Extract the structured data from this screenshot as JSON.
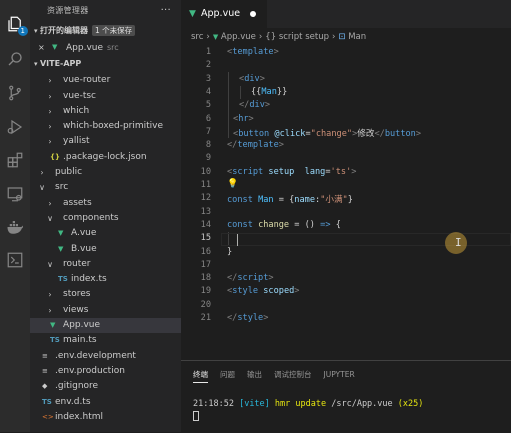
{
  "activity_bar": {
    "items": [
      "explorer-icon",
      "search-icon",
      "source-control-icon",
      "run-debug-icon",
      "extensions-icon",
      "remote-explorer-icon",
      "docker-icon",
      "terminal-icon"
    ],
    "explorer_badge": "1"
  },
  "sidebar": {
    "title": "资源管理器",
    "more": "···",
    "open_editors": {
      "header": "打开的编辑器",
      "unsaved_badge": "1 个未保存",
      "items": [
        {
          "close": "×",
          "name": "App.vue",
          "desc": "src"
        }
      ]
    },
    "project": {
      "header": "VITE-APP",
      "tree": [
        {
          "label": "vue-router",
          "type": "folder",
          "open": false,
          "depth": 1
        },
        {
          "label": "vue-tsc",
          "type": "folder",
          "open": false,
          "depth": 1
        },
        {
          "label": "which",
          "type": "folder",
          "open": false,
          "depth": 1
        },
        {
          "label": "which-boxed-primitive",
          "type": "folder",
          "open": false,
          "depth": 1
        },
        {
          "label": "yallist",
          "type": "folder",
          "open": false,
          "depth": 1
        },
        {
          "label": ".package-lock.json",
          "type": "json",
          "depth": 1
        },
        {
          "label": "public",
          "type": "folder",
          "open": false,
          "depth": 0
        },
        {
          "label": "src",
          "type": "folder",
          "open": true,
          "depth": 0
        },
        {
          "label": "assets",
          "type": "folder",
          "open": false,
          "depth": 1
        },
        {
          "label": "components",
          "type": "folder",
          "open": true,
          "depth": 1
        },
        {
          "label": "A.vue",
          "type": "vue",
          "depth": 2
        },
        {
          "label": "B.vue",
          "type": "vue",
          "depth": 2
        },
        {
          "label": "router",
          "type": "folder",
          "open": true,
          "depth": 1
        },
        {
          "label": "index.ts",
          "type": "ts",
          "depth": 2
        },
        {
          "label": "stores",
          "type": "folder",
          "open": false,
          "depth": 1
        },
        {
          "label": "views",
          "type": "folder",
          "open": false,
          "depth": 1
        },
        {
          "label": "App.vue",
          "type": "vue",
          "depth": 1,
          "active": true
        },
        {
          "label": "main.ts",
          "type": "ts",
          "depth": 1
        },
        {
          "label": ".env.development",
          "type": "env",
          "depth": 0
        },
        {
          "label": ".env.production",
          "type": "env",
          "depth": 0
        },
        {
          "label": ".gitignore",
          "type": "git",
          "depth": 0
        },
        {
          "label": "env.d.ts",
          "type": "ts",
          "depth": 0
        },
        {
          "label": "index.html",
          "type": "html",
          "depth": 0
        }
      ]
    }
  },
  "editor": {
    "tab": {
      "name": "App.vue",
      "modified": true
    },
    "breadcrumb": [
      "src",
      "App.vue",
      "{} script setup",
      "Man"
    ],
    "lines": [
      {
        "n": "1",
        "tokens": [
          [
            "brk",
            "<"
          ],
          [
            "tag",
            "template"
          ],
          [
            "brk",
            ">"
          ]
        ],
        "indent": 0
      },
      {
        "n": "2",
        "tokens": [],
        "indent": 0
      },
      {
        "n": "3",
        "tokens": [
          [
            "brk",
            "<"
          ],
          [
            "tag",
            "div"
          ],
          [
            "brk",
            ">"
          ]
        ],
        "indent": 1
      },
      {
        "n": "4",
        "tokens": [
          [
            "mus",
            "{{"
          ],
          [
            "var",
            "Man"
          ],
          [
            "mus",
            "}}"
          ]
        ],
        "indent": 2
      },
      {
        "n": "5",
        "tokens": [
          [
            "brk",
            "</"
          ],
          [
            "tag",
            "div"
          ],
          [
            "brk",
            ">"
          ]
        ],
        "indent": 1
      },
      {
        "n": "6",
        "tokens": [
          [
            "brk",
            "<"
          ],
          [
            "tag",
            "hr"
          ],
          [
            "brk",
            ">"
          ]
        ],
        "indent": 0.5
      },
      {
        "n": "7",
        "tokens": [
          [
            "brk",
            "<"
          ],
          [
            "tag",
            "button"
          ],
          [
            "txt",
            " "
          ],
          [
            "attr",
            "@click"
          ],
          [
            "txt",
            "="
          ],
          [
            "str",
            "\"change\""
          ],
          [
            "brk",
            ">"
          ],
          [
            "txt",
            "修改"
          ],
          [
            "brk",
            "</"
          ],
          [
            "tag",
            "button"
          ],
          [
            "brk",
            ">"
          ]
        ],
        "indent": 0.5
      },
      {
        "n": "8",
        "tokens": [
          [
            "brk",
            "</"
          ],
          [
            "tag",
            "template"
          ],
          [
            "brk",
            ">"
          ]
        ],
        "indent": 0
      },
      {
        "n": "9",
        "tokens": [],
        "indent": 0
      },
      {
        "n": "10",
        "tokens": [
          [
            "brk",
            "<"
          ],
          [
            "tag",
            "script"
          ],
          [
            "txt",
            " "
          ],
          [
            "attr",
            "setup"
          ],
          [
            "txt",
            "  "
          ],
          [
            "attr",
            "lang"
          ],
          [
            "txt",
            "="
          ],
          [
            "str",
            "'ts'"
          ],
          [
            "brk",
            ">"
          ]
        ],
        "indent": 0
      },
      {
        "n": "11",
        "tokens": [],
        "indent": 0,
        "bulb": "💡"
      },
      {
        "n": "12",
        "tokens": [
          [
            "kw",
            "const"
          ],
          [
            "txt",
            " "
          ],
          [
            "var",
            "Man"
          ],
          [
            "txt",
            " = {"
          ],
          [
            "attr",
            "name"
          ],
          [
            "txt",
            ":"
          ],
          [
            "str",
            "\"小满\""
          ],
          [
            "txt",
            "}"
          ]
        ],
        "indent": 0
      },
      {
        "n": "13",
        "tokens": [],
        "indent": 0
      },
      {
        "n": "14",
        "tokens": [
          [
            "kw",
            "const"
          ],
          [
            "txt",
            " "
          ],
          [
            "fn",
            "change"
          ],
          [
            "txt",
            " = () "
          ],
          [
            "kw",
            "=>"
          ],
          [
            "txt",
            " {"
          ]
        ],
        "indent": 0
      },
      {
        "n": "15",
        "tokens": [],
        "indent": 0,
        "current": true
      },
      {
        "n": "16",
        "tokens": [
          [
            "txt",
            "}"
          ]
        ],
        "indent": 0
      },
      {
        "n": "17",
        "tokens": [],
        "indent": 0
      },
      {
        "n": "18",
        "tokens": [
          [
            "brk",
            "</"
          ],
          [
            "tag",
            "script"
          ],
          [
            "brk",
            ">"
          ]
        ],
        "indent": 0
      },
      {
        "n": "19",
        "tokens": [
          [
            "brk",
            "<"
          ],
          [
            "tag",
            "style"
          ],
          [
            "txt",
            " "
          ],
          [
            "attr",
            "scoped"
          ],
          [
            "brk",
            ">"
          ]
        ],
        "indent": 0
      },
      {
        "n": "20",
        "tokens": [],
        "indent": 0
      },
      {
        "n": "21",
        "tokens": [
          [
            "brk",
            "</"
          ],
          [
            "tag",
            "style"
          ],
          [
            "brk",
            ">"
          ]
        ],
        "indent": 0
      }
    ]
  },
  "panel": {
    "tabs": [
      "终端",
      "问题",
      "输出",
      "调试控制台",
      "JUPYTER"
    ],
    "active_tab": "终端",
    "terminal": {
      "time": "21:18:52",
      "tag": "[vite]",
      "msg": "hmr update",
      "path": "/src/App.vue",
      "count": "(x25)"
    }
  }
}
